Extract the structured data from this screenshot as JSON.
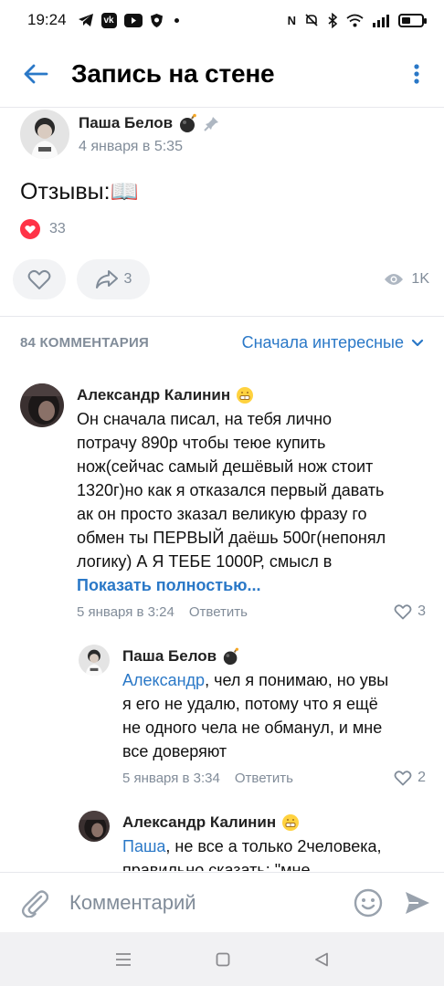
{
  "status_bar": {
    "time": "19:24",
    "notification_icons": [
      "telegram-icon",
      "vk-icon",
      "youtube-icon",
      "shield-icon"
    ],
    "system_icons": [
      "nfc-icon",
      "mute-icon",
      "bluetooth-icon",
      "wifi-icon",
      "signal-icon",
      "battery-icon"
    ]
  },
  "header": {
    "title": "Запись на стене"
  },
  "post": {
    "author": "Паша Белов",
    "date": "4 января в 5:35",
    "text": "Отзывы:📖",
    "reactions_count": "33",
    "share_count": "3",
    "views": "1K"
  },
  "comments_header": {
    "count_label": "84 КОММЕНТАРИЯ",
    "sort_label": "Сначала интересные"
  },
  "comments": [
    {
      "author": "Александр Калинин",
      "text_lines": [
        "Он сначала писал, на тебя лично",
        "потрачу 890р чтобы теюе купить",
        "нож(сейчас самый дешёвый нож стоит",
        "1320г)но как я отказался первый давать",
        "ак он просто зказал великую фразу го",
        "обмен ты ПЕРВЫЙ даёшь 500г(непонял",
        "логику) А Я ТЕБЕ 1000Р, смысл в"
      ],
      "show_more": "Показать полностью...",
      "date": "5 января в 3:24",
      "reply_label": "Ответить",
      "likes": "3"
    },
    {
      "author": "Паша Белов",
      "mention": "Александр",
      "text_first": ", чел я понимаю, но увы",
      "text_lines": [
        "я его не удалю, потому что я ещё",
        "не одного чела не обманул, и мне",
        "все доверяют"
      ],
      "date": "5 января в 3:34",
      "reply_label": "Ответить",
      "likes": "2"
    },
    {
      "author": "Александр Калинин",
      "mention": "Паша",
      "text_first": ", не все а только 2человека,",
      "text_partial": "правильно сказать: \"мне"
    }
  ],
  "input": {
    "placeholder": "Комментарий"
  },
  "colors": {
    "accent": "#2a78c7",
    "secondary_text": "#818c99",
    "reaction_red": "#ff3347"
  }
}
